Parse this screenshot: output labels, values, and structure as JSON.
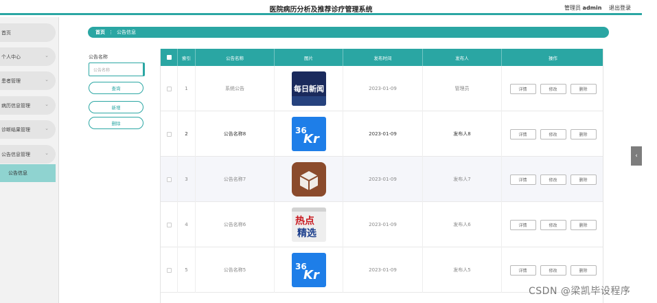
{
  "header": {
    "title": "医院病历分析及推荐诊疗管理系统",
    "role_label": "管理员",
    "username": "admin",
    "logout_label": "退出登录"
  },
  "sidebar": {
    "items": [
      {
        "label": "首页",
        "has_chevron": false
      },
      {
        "label": "个人中心",
        "has_chevron": true
      },
      {
        "label": "患者管理",
        "has_chevron": true
      },
      {
        "label": "病历信息管理",
        "has_chevron": true
      },
      {
        "label": "诊断结果管理",
        "has_chevron": true
      },
      {
        "label": "公告信息管理",
        "has_chevron": true
      }
    ],
    "active_sub": "公告信息",
    "chevron": "⌄"
  },
  "breadcrumb": {
    "home": "首页",
    "separator": "⋮",
    "current": "公告信息"
  },
  "search": {
    "label": "公告名称",
    "placeholder": "公告名称",
    "query_label": "查询",
    "add_label": "新增",
    "delete_label": "删除"
  },
  "table": {
    "headers": [
      "",
      "索引",
      "公告名称",
      "图片",
      "发布时间",
      "发布人",
      "操作"
    ],
    "rows": [
      {
        "index": "1",
        "name": "系统公告",
        "image": "daily-news-icon",
        "time": "2023-01-09",
        "publisher": "管理员"
      },
      {
        "index": "2",
        "name": "公告名称8",
        "image": "36kr-icon",
        "time": "2023-01-09",
        "publisher": "发布人8"
      },
      {
        "index": "3",
        "name": "公告名称7",
        "image": "cydia-box-icon",
        "time": "2023-01-09",
        "publisher": "发布人7"
      },
      {
        "index": "4",
        "name": "公告名称6",
        "image": "hot-picks-icon",
        "time": "2023-01-09",
        "publisher": "发布人6"
      },
      {
        "index": "5",
        "name": "公告名称5",
        "image": "36kr-icon",
        "time": "2023-01-09",
        "publisher": "发布人5"
      }
    ],
    "actions": {
      "detail": "详情",
      "edit": "修改",
      "delete": "删除"
    },
    "thumb_text": {
      "daily": "每日新闻",
      "kr_num": "36",
      "kr_letters": "Kr",
      "hot1": "热点",
      "hot2": "精选"
    }
  },
  "side_tab_glyph": "‹",
  "watermark": "CSDN @梁凯毕设程序",
  "colors": {
    "accent": "#2aa6a3",
    "sub_active": "#8fd3d0",
    "kr_blue": "#1e7ee8",
    "news_navy": "#1a2a5c"
  }
}
